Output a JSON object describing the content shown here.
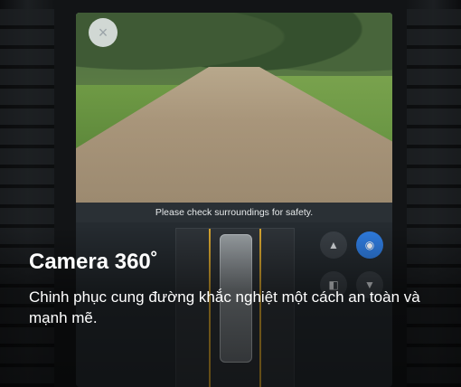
{
  "camera": {
    "close_symbol": "×",
    "warning_text": "Please check surroundings for safety."
  },
  "view_buttons": [
    {
      "icon": "front-camera-icon",
      "symbol": "▲",
      "active": false
    },
    {
      "icon": "view-mode-icon",
      "symbol": "◉",
      "active": true
    },
    {
      "icon": "side-camera-icon",
      "symbol": "◧",
      "active": false
    },
    {
      "icon": "rear-camera-icon",
      "symbol": "▼",
      "active": false
    }
  ],
  "caption": {
    "title": "Camera 360˚",
    "description": "Chinh phục cung đường khắc nghiệt một cách an toàn và mạnh mẽ."
  },
  "colors": {
    "accent": "#2f7de1",
    "guide": "#d8a630"
  }
}
